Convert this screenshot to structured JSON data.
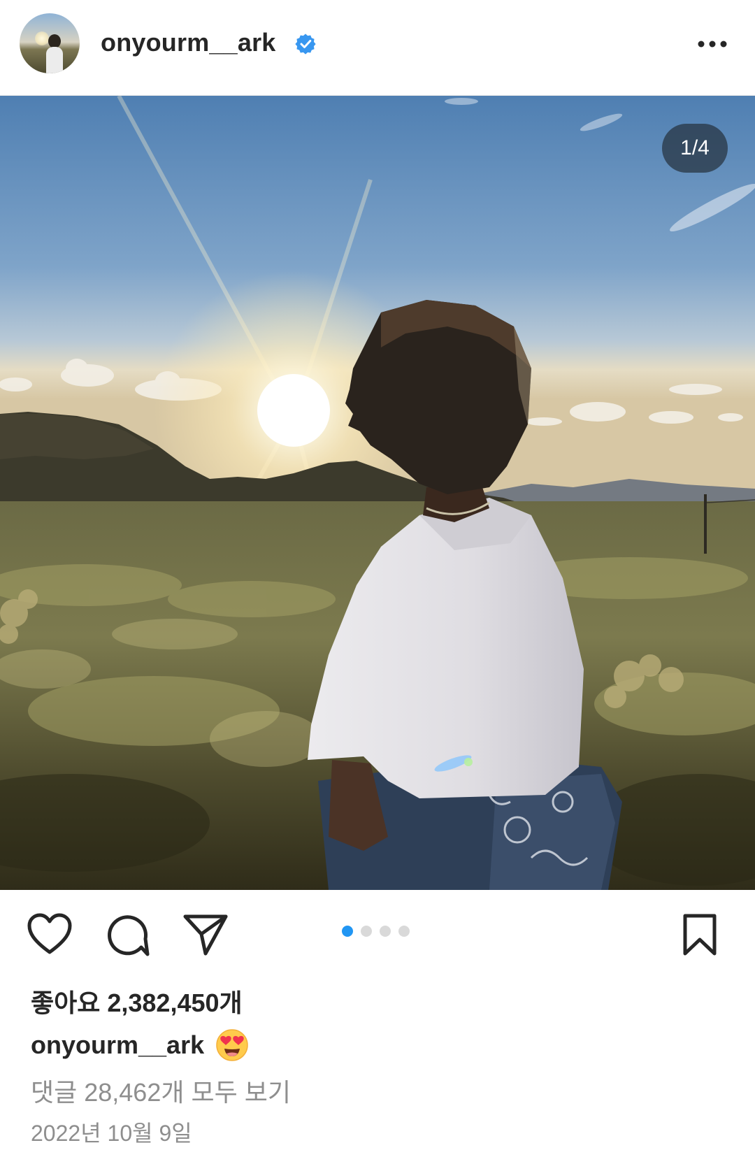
{
  "post": {
    "username": "onyourm__ark",
    "verified": true,
    "counter": "1/4",
    "photo_alt": "sunset-desert-portrait",
    "carousel": {
      "total": 4,
      "active_index": 0
    },
    "likes": "좋아요 2,382,450개",
    "caption": {
      "username": "onyourm__ark",
      "emoji": "heart-eyes-emoji"
    },
    "view_comments": "댓글 28,462개 모두 보기",
    "date": "2022년 10월 9일"
  },
  "icons": {
    "verified": "verified-badge-icon",
    "more": "more-options-icon",
    "like": "heart-icon",
    "comment": "comment-icon",
    "share": "send-icon",
    "save": "bookmark-icon"
  },
  "colors": {
    "text": "#262626",
    "secondary_text": "#8e8e8e",
    "verified_blue": "#3897f0",
    "active_dot": "#2196f3",
    "inactive_dot": "#d9d9d9"
  }
}
